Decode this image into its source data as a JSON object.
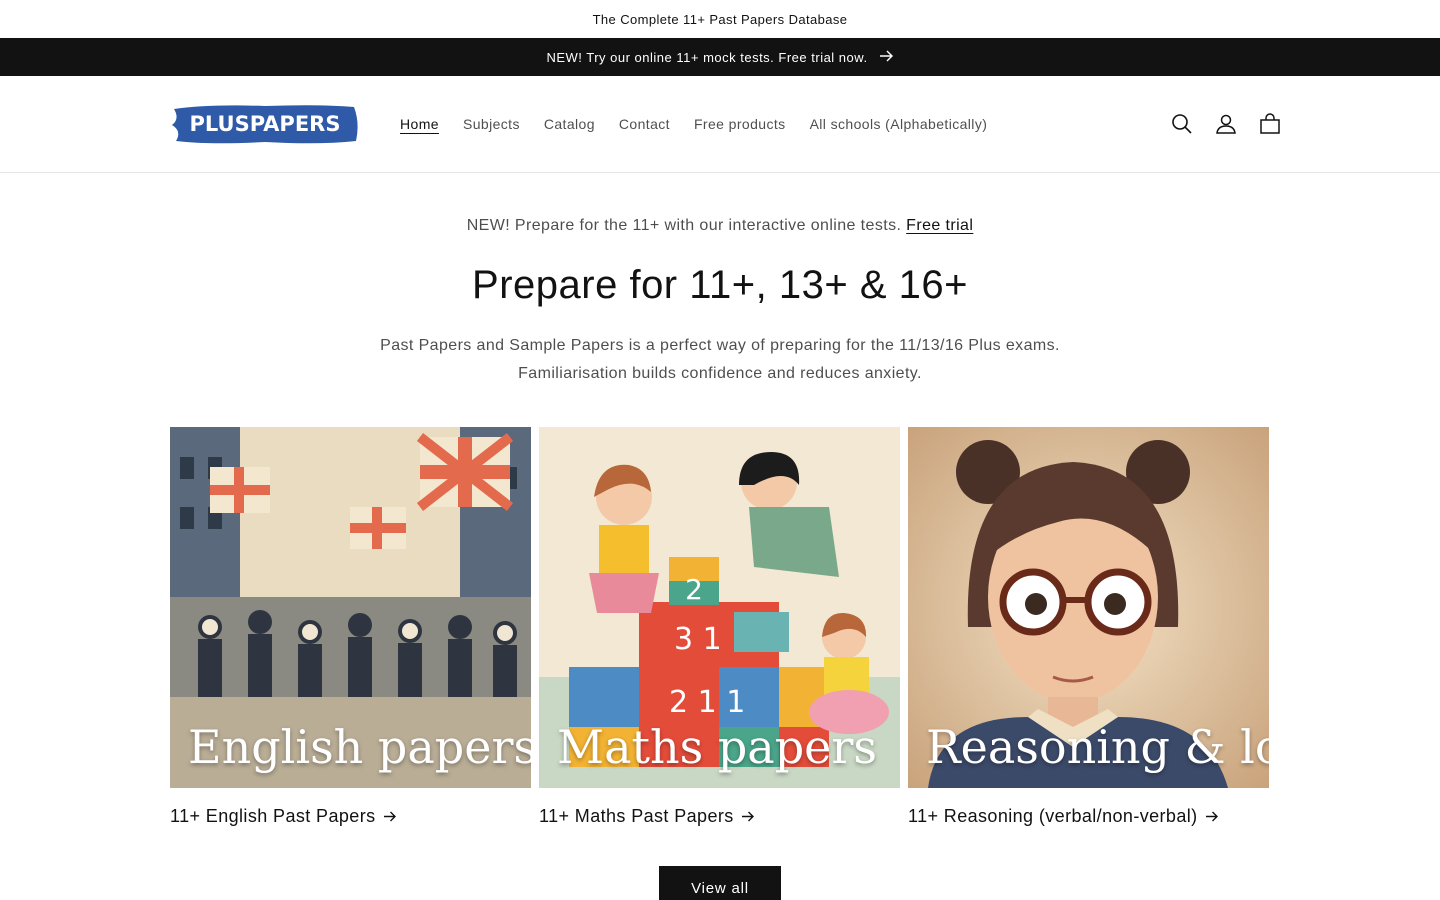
{
  "top_strip": {
    "text": "The Complete 11+ Past Papers Database"
  },
  "announcement": {
    "text": "NEW! Try our online 11+ mock tests. Free trial now.",
    "arrow_icon": "arrow-right-icon"
  },
  "header": {
    "logo_text": "PLUSPAPERS",
    "nav": [
      {
        "label": "Home",
        "active": true
      },
      {
        "label": "Subjects"
      },
      {
        "label": "Catalog"
      },
      {
        "label": "Contact"
      },
      {
        "label": "Free products"
      },
      {
        "label": "All schools (Alphabetically)"
      }
    ],
    "icons": [
      "search-icon",
      "account-icon",
      "cart-icon"
    ]
  },
  "hero": {
    "promo_text": "NEW! Prepare for the 11+ with our interactive online tests.",
    "promo_link": "Free trial",
    "title": "Prepare for 11+, 13+ & 16+",
    "description": "Past Papers and Sample Papers is a perfect way of preparing for the 11/13/16 Plus exams. Familiarisation builds confidence and reduces anxiety."
  },
  "cards": [
    {
      "overlay": "English papers",
      "link": "11+ English Past Papers"
    },
    {
      "overlay": "Maths papers",
      "link": "11+ Maths Past Papers"
    },
    {
      "overlay": "Reasoning & logic",
      "link": "11+ Reasoning (verbal/non-verbal)"
    }
  ],
  "view_all": "View all",
  "colors": {
    "logo_blue": "#2f5aa8",
    "dark": "#121212"
  }
}
